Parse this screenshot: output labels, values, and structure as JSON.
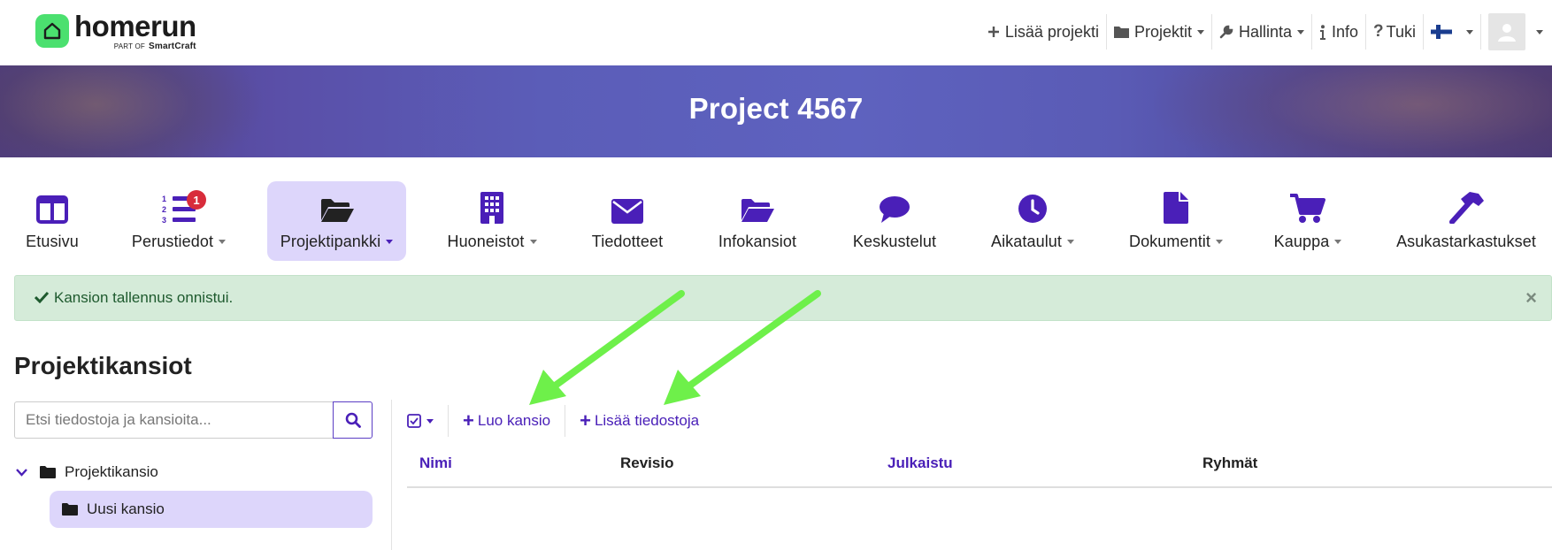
{
  "brand": {
    "name": "homerun",
    "part_of_prefix": "PART OF",
    "part_of_company": "SmartCraft",
    "accent": "#4be06f"
  },
  "topnav": {
    "add_project": "Lisää projekti",
    "projects": "Projektit",
    "admin": "Hallinta",
    "info": "Info",
    "support": "Tuki"
  },
  "banner": {
    "title": "Project 4567"
  },
  "mainnav": {
    "items": [
      {
        "label": "Etusivu",
        "icon": "layout-columns-icon",
        "dropdown": false
      },
      {
        "label": "Perustiedot",
        "icon": "numbered-list-icon",
        "dropdown": true,
        "badge": "1"
      },
      {
        "label": "Projektipankki",
        "icon": "folder-open-icon",
        "dropdown": true,
        "active": true
      },
      {
        "label": "Huoneistot",
        "icon": "building-icon",
        "dropdown": true
      },
      {
        "label": "Tiedotteet",
        "icon": "envelope-icon",
        "dropdown": false
      },
      {
        "label": "Infokansiot",
        "icon": "folder-open-icon",
        "dropdown": false
      },
      {
        "label": "Keskustelut",
        "icon": "chat-bubble-icon",
        "dropdown": false
      },
      {
        "label": "Aikataulut",
        "icon": "clock-icon",
        "dropdown": true
      },
      {
        "label": "Dokumentit",
        "icon": "file-icon",
        "dropdown": true
      },
      {
        "label": "Kauppa",
        "icon": "cart-icon",
        "dropdown": true
      },
      {
        "label": "Asukastarkastukset",
        "icon": "hammer-icon",
        "dropdown": false
      }
    ],
    "accent": "#4a1fb8",
    "active_bg": "#ddd6fb"
  },
  "alert": {
    "message": "Kansion tallennus onnistui.",
    "close": "×",
    "bg": "#d5ebd9"
  },
  "section": {
    "title": "Projektikansiot"
  },
  "search": {
    "placeholder": "Etsi tiedostoja ja kansioita...",
    "value": ""
  },
  "tree": {
    "root": "Projektikansio",
    "child": "Uusi kansio"
  },
  "toolbar": {
    "create_folder": "Luo kansio",
    "add_files": "Lisää tiedostoja"
  },
  "table": {
    "columns": [
      "Nimi",
      "Revisio",
      "Julkaistu",
      "Ryhmät"
    ]
  },
  "annotation": {
    "arrow_color": "#6ef04a"
  }
}
